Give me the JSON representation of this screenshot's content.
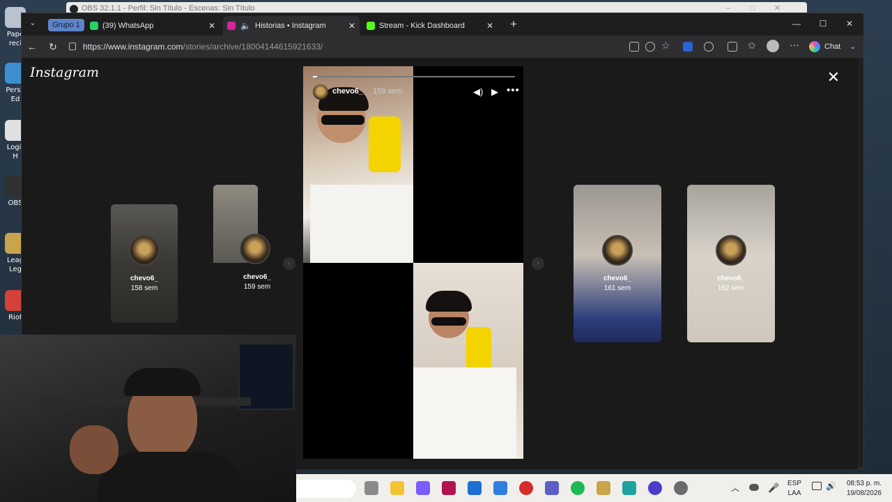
{
  "obs": {
    "title": "OBS 32.1.1 - Perfil: Sin Título - Escenas: Sin Título"
  },
  "desktop": {
    "icons": [
      {
        "label": "Pape\nreci",
        "color": "#b9c3cf"
      },
      {
        "label": "Perso\nEd",
        "color": "#3d8fd1"
      },
      {
        "label": "Logit\nH",
        "color": "#e0e0e0"
      },
      {
        "label": "OBS",
        "color": "#303030"
      },
      {
        "label": "Leag\nLeg",
        "color": "#c9a44a"
      },
      {
        "label": "Riot",
        "color": "#d4403a"
      }
    ]
  },
  "browser": {
    "tab_group": "Grupo 1",
    "tabs": [
      {
        "title": "(39) WhatsApp",
        "favicon_color": "#25d366",
        "active": false
      },
      {
        "title": "Historias • Instagram",
        "favicon_color": "#d6249f",
        "active": true
      },
      {
        "title": "Stream - Kick Dashboard",
        "favicon_color": "#53fc18",
        "active": false
      }
    ],
    "url_host": "https://www.instagram.com",
    "url_path": "/stories/archive/18004144615921633/",
    "chat_label": "Chat"
  },
  "instagram": {
    "logo": "Instagram",
    "story": {
      "username": "chevo6_",
      "age": "159 sem",
      "progress": 0.02
    },
    "thumbs": [
      {
        "username": "chevo6_",
        "age": "158 sem"
      },
      {
        "username": "chevo6_",
        "age": "159 sem"
      },
      {
        "username": "chevo6_",
        "age": "161 sem"
      },
      {
        "username": "chevo6_",
        "age": "162 sem"
      }
    ]
  },
  "taskbar": {
    "lang_top": "ESP",
    "lang_bottom": "LAA",
    "time": "08:53 p. m.",
    "date": "19/08/2026",
    "apps": [
      {
        "name": "task-view",
        "color": "#8a8a8a"
      },
      {
        "name": "file-explorer",
        "color": "#f4c430"
      },
      {
        "name": "copilot",
        "color": "#7b5cff"
      },
      {
        "name": "app-pink",
        "color": "#b3124e"
      },
      {
        "name": "outlook",
        "color": "#1d6fd1"
      },
      {
        "name": "store",
        "color": "#2f7fe0"
      },
      {
        "name": "app-red",
        "color": "#d62b2b"
      },
      {
        "name": "teams",
        "color": "#5b5fc7"
      },
      {
        "name": "spotify",
        "color": "#1db954"
      },
      {
        "name": "league",
        "color": "#c9a44a"
      },
      {
        "name": "edge",
        "color": "#1fa3a0"
      },
      {
        "name": "app-purple",
        "color": "#4b3cc9"
      },
      {
        "name": "settings",
        "color": "#6b6b6b"
      }
    ]
  }
}
